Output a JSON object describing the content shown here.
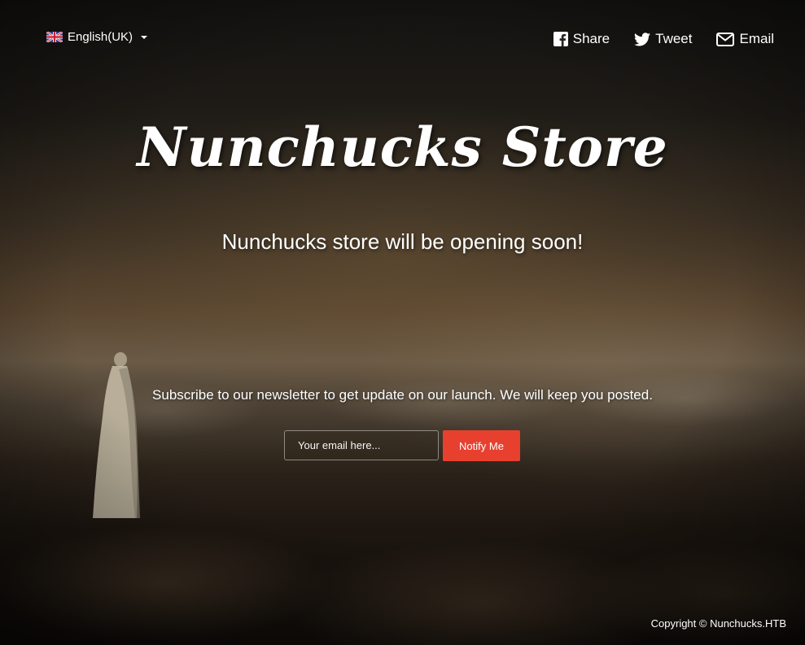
{
  "language": {
    "label": "English(UK)",
    "flag_icon": "uk-flag-icon"
  },
  "share": {
    "items": [
      {
        "label": "Share",
        "icon": "facebook-icon"
      },
      {
        "label": "Tweet",
        "icon": "twitter-icon"
      },
      {
        "label": "Email",
        "icon": "envelope-icon"
      }
    ]
  },
  "hero": {
    "title": "Nunchucks Store",
    "tagline": "Nunchucks store will be opening soon!"
  },
  "newsletter": {
    "text": "Subscribe to our newsletter to get update on our launch. We will keep you posted.",
    "email_placeholder": "Your email here...",
    "button_label": "Notify Me"
  },
  "footer": {
    "copyright": "Copyright © Nunchucks.HTB"
  },
  "colors": {
    "accent": "#e8402f",
    "text": "#ffffff"
  }
}
